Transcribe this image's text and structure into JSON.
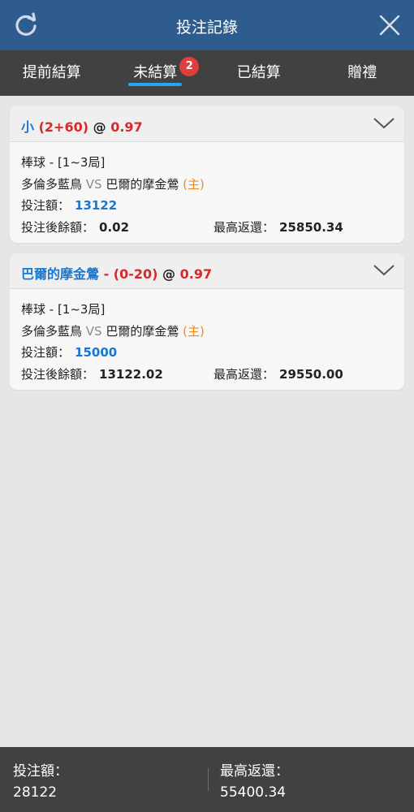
{
  "header": {
    "title": "投注記錄",
    "left_icon": "refresh-icon",
    "right_icon": "close-icon",
    "bg_color": "#2f5c8e"
  },
  "tabs": [
    {
      "label": "提前結算",
      "active": false
    },
    {
      "label": "未結算",
      "active": true,
      "badge": "2"
    },
    {
      "label": "已結算",
      "active": false
    },
    {
      "label": "贈禮",
      "active": false
    }
  ],
  "bets": [
    {
      "selection": "小",
      "handicap": "(2+60)",
      "at": "@",
      "odds": "0.97",
      "sport": "棒球 - [1~3局]",
      "team_a": "多倫多藍鳥",
      "vs": "VS",
      "team_b": "巴爾的摩金鶯",
      "home_mark": "(主)",
      "stake_label": "投注額：",
      "stake": "13122",
      "balance_label": "投注後餘額：",
      "balance": "0.02",
      "max_return_label": "最高返還：",
      "max_return": "25850.34"
    },
    {
      "selection": "巴爾的摩金鶯",
      "handicap": "- (0-20)",
      "at": "@",
      "odds": "0.97",
      "sport": "棒球 - [1~3局]",
      "team_a": "多倫多藍鳥",
      "vs": "VS",
      "team_b": "巴爾的摩金鶯",
      "home_mark": "(主)",
      "stake_label": "投注額：",
      "stake": "15000",
      "balance_label": "投注後餘額：",
      "balance": "13122.02",
      "max_return_label": "最高返還：",
      "max_return": "29550.00"
    }
  ],
  "footer": {
    "total_stake_label": "投注額：",
    "total_stake": "28122",
    "total_return_label": "最高返還：",
    "total_return": "55400.34"
  }
}
